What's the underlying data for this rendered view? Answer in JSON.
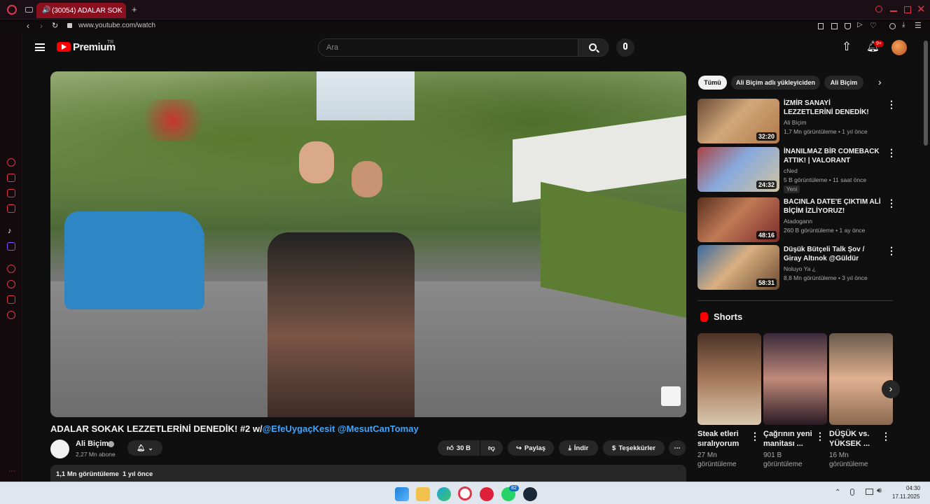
{
  "browser": {
    "tab_title": "(30054) ADALAR SOK",
    "url": "www.youtube.com/watch"
  },
  "header": {
    "logo": "Premium",
    "region": "TR",
    "search_placeholder": "Ara",
    "notif_count": "9+"
  },
  "video": {
    "title_prefix": "ADALAR SOKAK LEZZETLERİNİ DENEDİK! #2 w/",
    "mention1": "@EfeUygaçKesit",
    "mention2": "@MesutCanTomay",
    "channel": "Ali Biçim",
    "subs": "2,27 Mn abone",
    "likes": "30 B",
    "share": "Paylaş",
    "download": "İndir",
    "thanks": "Teşekkürler",
    "desc_meta": "1,1 Mn görüntüleme  1 yıl önce"
  },
  "chips": [
    "Tümü",
    "Ali Biçim adlı yükleyiciden",
    "Ali Biçim"
  ],
  "related": [
    {
      "title": "İZMİR SANAYİ LEZZETLERİNİ DENEDİK! @EfeUygacKesit ...",
      "channel": "Ali Biçim",
      "meta": "1,7 Mn görüntüleme • 1 yıl önce",
      "dur": "32:20",
      "badge": ""
    },
    {
      "title": "İNANILMAZ BİR COMEBACK ATTIK! | VALORANT RANKED",
      "channel": "cNed",
      "meta": "5 B görüntüleme • 11 saat önce",
      "dur": "24:32",
      "badge": "Yeni"
    },
    {
      "title": "BACINLA DATE'E ÇIKTIM ALİ BİÇİM İZLİYORUZ!",
      "channel": "Atadogann",
      "meta": "260 B görüntüleme • 1 ay önce",
      "dur": "48:16",
      "badge": ""
    },
    {
      "title": "Düşük Bütçeli Talk Şov / Giray Altınok @Güldür Güldür",
      "channel": "Noluyo Ya ¿",
      "meta": "8,8 Mn görüntüleme • 3 yıl önce",
      "dur": "58:31",
      "badge": ""
    }
  ],
  "shorts": {
    "heading": "Shorts",
    "items": [
      {
        "title": "Steak etleri sıralıyorum",
        "views": "27 Mn görüntüleme"
      },
      {
        "title": "Çağrının yeni manitası ...",
        "views": "901 B görüntüleme"
      },
      {
        "title": "DÜŞÜK vs. YÜKSEK ...",
        "views": "16 Mn görüntüleme"
      }
    ]
  },
  "taskbar": {
    "time": "04:30",
    "date": "17.11.2025",
    "whatsapp_badge": "82"
  },
  "colors": {
    "accent": "#ff0000",
    "link": "#3ea6ff",
    "opera": "#e0364b"
  }
}
